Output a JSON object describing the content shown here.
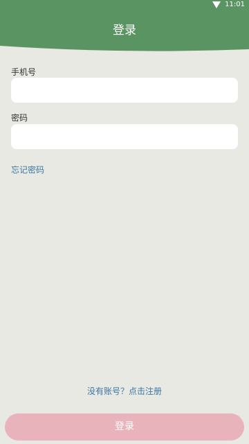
{
  "status_bar": {
    "time": "11:01",
    "background_color": "#5a9463",
    "icons": [
      "wifi-icon"
    ]
  },
  "header": {
    "title": "登录",
    "background_color": "#5a9463"
  },
  "form": {
    "phone_label": "手机号",
    "phone_value": "",
    "password_label": "密码",
    "password_value": "",
    "forgot_password": "忘记密码",
    "link_color": "#3d76a3"
  },
  "footer": {
    "register_text": "没有账号？点击注册",
    "login_button": "登录",
    "login_button_color": "#e8b3bb"
  },
  "page": {
    "background_color": "#e8e9e3"
  }
}
